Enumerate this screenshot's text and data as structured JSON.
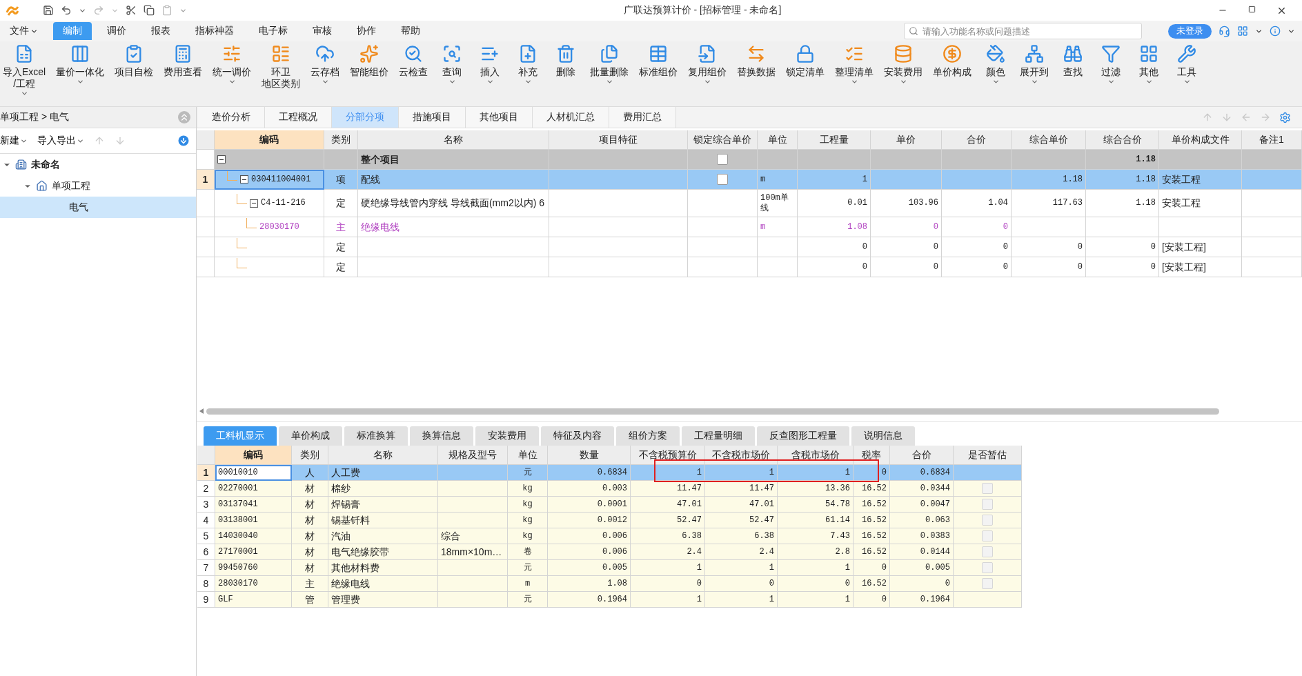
{
  "window": {
    "title": "广联达预算计价 - [招标管理 - 未命名]"
  },
  "menu": [
    {
      "label": "文件",
      "dropdown": true,
      "selected": false
    },
    {
      "label": "编制",
      "selected": true
    },
    {
      "label": "调价",
      "selected": false
    },
    {
      "label": "报表",
      "selected": false
    },
    {
      "label": "指标神器",
      "selected": false
    },
    {
      "label": "电子标",
      "selected": false
    },
    {
      "label": "审核",
      "selected": false
    },
    {
      "label": "协作",
      "selected": false
    },
    {
      "label": "帮助",
      "selected": false
    }
  ],
  "search": {
    "placeholder": "请输入功能名称或问题描述"
  },
  "login_button": "未登录",
  "ribbon": [
    {
      "lines": [
        "导入Excel",
        "/工程"
      ],
      "dropdown": true
    },
    {
      "lines": [
        "量价一体化"
      ],
      "dropdown": true
    },
    {
      "lines": [
        "项目自检"
      ],
      "dropdown": false
    },
    {
      "lines": [
        "费用查看"
      ],
      "dropdown": false
    },
    {
      "lines": [
        "统一调价"
      ],
      "dropdown": true
    },
    {
      "lines": [
        "环卫",
        "地区类别"
      ],
      "dropdown": false
    },
    {
      "lines": [
        "云存档"
      ],
      "dropdown": true
    },
    {
      "lines": [
        "智能组价"
      ],
      "dropdown": false
    },
    {
      "lines": [
        "云检查"
      ],
      "dropdown": false
    },
    {
      "lines": [
        "查询"
      ],
      "dropdown": true
    },
    {
      "lines": [
        "插入"
      ],
      "dropdown": true
    },
    {
      "lines": [
        "补充"
      ],
      "dropdown": true
    },
    {
      "lines": [
        "删除"
      ],
      "dropdown": false
    },
    {
      "lines": [
        "批量删除"
      ],
      "dropdown": true
    },
    {
      "lines": [
        "标准组价"
      ],
      "dropdown": false
    },
    {
      "lines": [
        "复用组价"
      ],
      "dropdown": true
    },
    {
      "lines": [
        "替换数据"
      ],
      "dropdown": false
    },
    {
      "lines": [
        "锁定清单"
      ],
      "dropdown": false
    },
    {
      "lines": [
        "整理清单"
      ],
      "dropdown": true
    },
    {
      "lines": [
        "安装费用"
      ],
      "dropdown": true
    },
    {
      "lines": [
        "单价构成"
      ],
      "dropdown": false
    },
    {
      "lines": [
        "颜色"
      ],
      "dropdown": true
    },
    {
      "lines": [
        "展开到"
      ],
      "dropdown": true
    },
    {
      "lines": [
        "查找"
      ],
      "dropdown": false
    },
    {
      "lines": [
        "过滤"
      ],
      "dropdown": true
    },
    {
      "lines": [
        "其他"
      ],
      "dropdown": true
    },
    {
      "lines": [
        "工具"
      ],
      "dropdown": true
    }
  ],
  "sidebar": {
    "breadcrumb": "单项工程 > 电气",
    "actions": [
      {
        "label": "新建",
        "dropdown": true
      },
      {
        "label": "导入导出",
        "dropdown": true
      }
    ],
    "tree": [
      {
        "label": "未命名",
        "kind": "project",
        "expanded": true,
        "selected": false,
        "children": [
          {
            "label": "单项工程",
            "kind": "single",
            "expanded": true,
            "selected": false,
            "children": [
              {
                "label": "电气",
                "selected": true
              }
            ]
          }
        ]
      }
    ]
  },
  "tabs": [
    {
      "label": "造价分析",
      "selected": false
    },
    {
      "label": "工程概况",
      "selected": false
    },
    {
      "label": "分部分项",
      "selected": true
    },
    {
      "label": "措施项目",
      "selected": false
    },
    {
      "label": "其他项目",
      "selected": false
    },
    {
      "label": "人材机汇总",
      "selected": false
    },
    {
      "label": "费用汇总",
      "selected": false
    }
  ],
  "table": {
    "columns": [
      "编码",
      "类别",
      "名称",
      "项目特征",
      "锁定综合单价",
      "单位",
      "工程量",
      "单价",
      "合价",
      "综合单价",
      "综合合价",
      "单价构成文件",
      "备注1"
    ],
    "rows": [
      {
        "kind": "root",
        "name": "整个项目",
        "expanded": true,
        "locked": false,
        "selected": false,
        "comp_total": "1.18",
        "children": [
          {
            "kind": "item",
            "row_number": "1",
            "code": "030411004001",
            "type": "项",
            "name": "配线",
            "expanded": true,
            "locked": false,
            "selected": true,
            "unit": "m",
            "qty": "1",
            "comp_price": "1.18",
            "comp_total": "1.18",
            "file": "安装工程",
            "children": [
              {
                "kind": "quota",
                "code": "C4-11-216",
                "type": "定",
                "name": "硬绝缘导线管内穿线 导线截面(mm2以内) 6",
                "expanded": true,
                "selected": false,
                "unit": "100m单线",
                "qty": "0.01",
                "price": "103.96",
                "total": "1.04",
                "comp_price": "117.63",
                "comp_total": "1.18",
                "file": "安装工程",
                "children": [
                  {
                    "kind": "main",
                    "code": "28030170",
                    "type": "主",
                    "name": "绝缘电线",
                    "selected": false,
                    "unit": "m",
                    "qty": "1.08",
                    "price": "0",
                    "total": "0"
                  }
                ]
              },
              {
                "kind": "quota",
                "type": "定",
                "selected": false,
                "qty": "0",
                "price": "0",
                "total": "0",
                "comp_price": "0",
                "comp_total": "0",
                "file": "[安装工程]"
              },
              {
                "kind": "quota",
                "type": "定",
                "selected": false,
                "qty": "0",
                "price": "0",
                "total": "0",
                "comp_price": "0",
                "comp_total": "0",
                "file": "[安装工程]"
              }
            ]
          }
        ]
      }
    ]
  },
  "detail_tabs": [
    {
      "label": "工料机显示",
      "selected": true
    },
    {
      "label": "单价构成",
      "selected": false
    },
    {
      "label": "标准换算",
      "selected": false
    },
    {
      "label": "换算信息",
      "selected": false
    },
    {
      "label": "安装费用",
      "selected": false
    },
    {
      "label": "特征及内容",
      "selected": false
    },
    {
      "label": "组价方案",
      "selected": false
    },
    {
      "label": "工程量明细",
      "selected": false
    },
    {
      "label": "反查图形工程量",
      "selected": false
    },
    {
      "label": "说明信息",
      "selected": false
    }
  ],
  "detail_table": {
    "columns": [
      "编码",
      "类别",
      "名称",
      "规格及型号",
      "单位",
      "数量",
      "不含税预算价",
      "不含税市场价",
      "含税市场价",
      "税率",
      "合价",
      "是否暂估"
    ],
    "rows": [
      {
        "num": "1",
        "code": "00010010",
        "type": "人",
        "name": "人工费",
        "unit": "元",
        "qty": "0.6834",
        "budget": "1",
        "market": "1",
        "market_tax": "1",
        "rate": "0",
        "total": "0.6834",
        "selected": true,
        "highlighted": true
      },
      {
        "num": "2",
        "code": "02270001",
        "type": "材",
        "name": "棉纱",
        "unit": "kg",
        "qty": "0.003",
        "budget": "11.47",
        "market": "11.47",
        "market_tax": "13.36",
        "rate": "16.52",
        "total": "0.0344",
        "selected": false,
        "highlighted": false,
        "provisional": false
      },
      {
        "num": "3",
        "code": "03137041",
        "type": "材",
        "name": "焊锡膏",
        "unit": "kg",
        "qty": "0.0001",
        "budget": "47.01",
        "market": "47.01",
        "market_tax": "54.78",
        "rate": "16.52",
        "total": "0.0047",
        "selected": false,
        "highlighted": false,
        "provisional": false
      },
      {
        "num": "4",
        "code": "03138001",
        "type": "材",
        "name": "锡基钎料",
        "unit": "kg",
        "qty": "0.0012",
        "budget": "52.47",
        "market": "52.47",
        "market_tax": "61.14",
        "rate": "16.52",
        "total": "0.063",
        "selected": false,
        "highlighted": false,
        "provisional": false
      },
      {
        "num": "5",
        "code": "14030040",
        "type": "材",
        "name": "汽油",
        "spec": "综合",
        "unit": "kg",
        "qty": "0.006",
        "budget": "6.38",
        "market": "6.38",
        "market_tax": "7.43",
        "rate": "16.52",
        "total": "0.0383",
        "selected": false,
        "highlighted": false,
        "provisional": false
      },
      {
        "num": "6",
        "code": "27170001",
        "type": "材",
        "name": "电气绝缘胶带",
        "spec": "18mm×10m…",
        "unit": "卷",
        "qty": "0.006",
        "budget": "2.4",
        "market": "2.4",
        "market_tax": "2.8",
        "rate": "16.52",
        "total": "0.0144",
        "selected": false,
        "highlighted": false,
        "provisional": false
      },
      {
        "num": "7",
        "code": "99450760",
        "type": "材",
        "name": "其他材料费",
        "unit": "元",
        "qty": "0.005",
        "budget": "1",
        "market": "1",
        "market_tax": "1",
        "rate": "0",
        "total": "0.005",
        "selected": false,
        "highlighted": false,
        "provisional": false
      },
      {
        "num": "8",
        "code": "28030170",
        "type": "主",
        "name": "绝缘电线",
        "unit": "m",
        "qty": "1.08",
        "budget": "0",
        "market": "0",
        "market_tax": "0",
        "rate": "16.52",
        "total": "0",
        "selected": false,
        "highlighted": false,
        "provisional": false
      },
      {
        "num": "9",
        "code": "GLF",
        "type": "管",
        "name": "管理费",
        "unit": "元",
        "qty": "0.1964",
        "budget": "1",
        "market": "1",
        "market_tax": "1",
        "rate": "0",
        "total": "0.1964",
        "selected": false,
        "highlighted": false
      }
    ]
  }
}
